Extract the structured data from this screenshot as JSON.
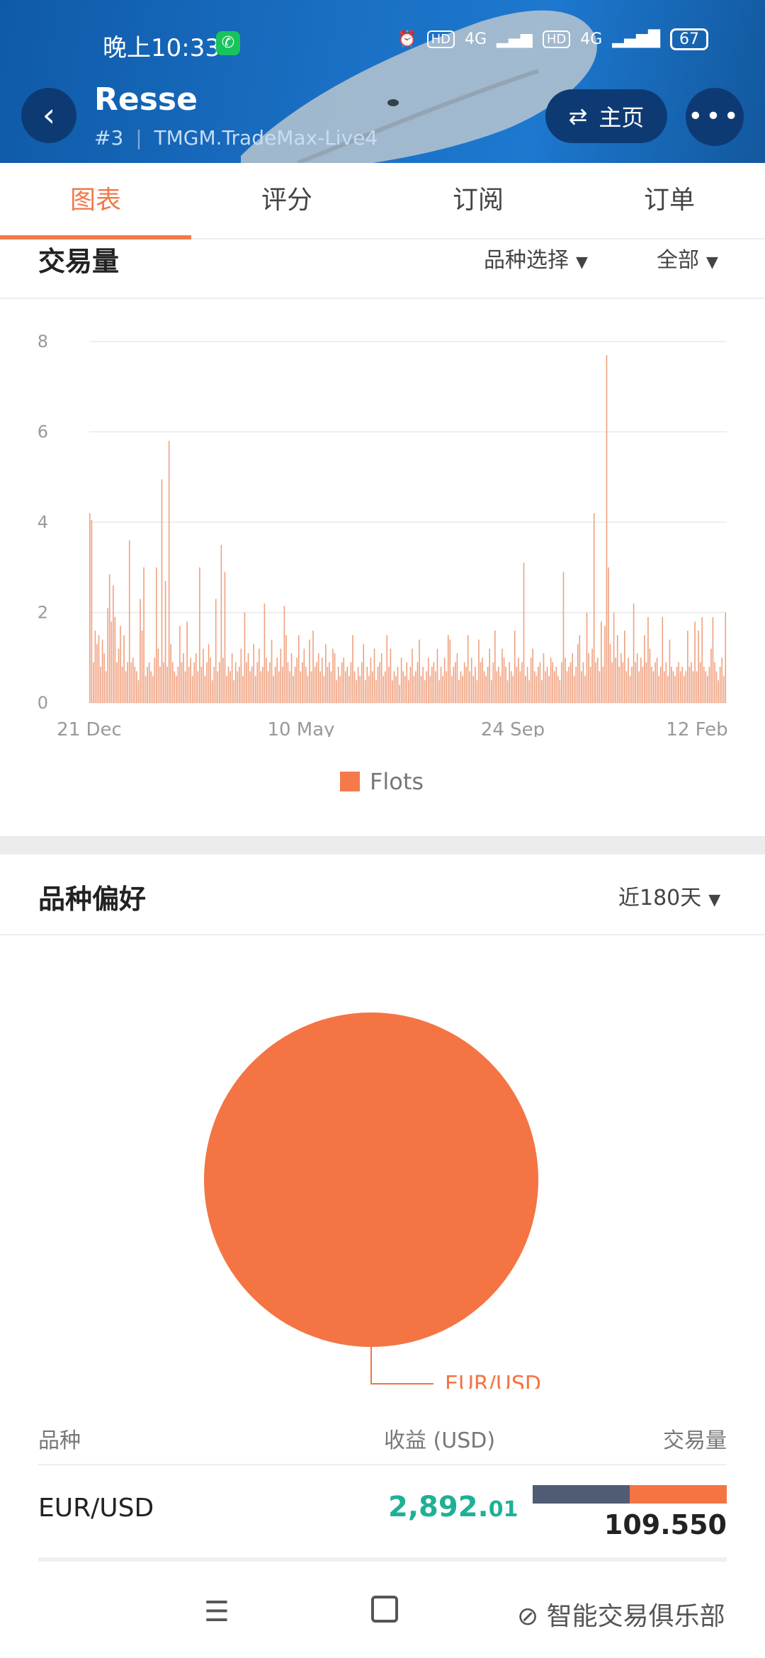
{
  "status_bar": {
    "time": "晚上10:33",
    "battery": "67",
    "network1": "4G",
    "network2": "4G",
    "hd": "HD"
  },
  "header": {
    "title": "Resse",
    "rank": "#3",
    "account": "TMGM.TradeMax-Live4",
    "home_label": "主页"
  },
  "tabs": [
    {
      "label": "图表",
      "active": true
    },
    {
      "label": "评分",
      "active": false
    },
    {
      "label": "订阅",
      "active": false
    },
    {
      "label": "订单",
      "active": false
    }
  ],
  "volume_section": {
    "title": "交易量",
    "filter_symbol": "品种选择",
    "filter_range": "全部"
  },
  "chart_data": [
    {
      "type": "bar",
      "title": "",
      "series": [
        {
          "name": "Flots",
          "color": "#f0a07e"
        }
      ],
      "x_tick_labels": [
        "21 Dec",
        "10 May",
        "24 Sep",
        "12 Feb"
      ],
      "y_ticks": [
        0,
        2,
        4,
        6,
        8
      ],
      "ylim": [
        0,
        8
      ],
      "grid": true,
      "legend": "bottom",
      "values": [
        4.2,
        4.05,
        0.9,
        1.6,
        1.3,
        1.5,
        0.8,
        1.4,
        1.1,
        0.7,
        2.1,
        2.85,
        1.8,
        2.6,
        1.9,
        0.9,
        1.2,
        1.7,
        0.8,
        1.5,
        0.7,
        0.9,
        3.6,
        0.9,
        1.0,
        0.8,
        0.7,
        0.5,
        2.3,
        1.6,
        3.0,
        0.6,
        0.8,
        0.9,
        0.7,
        0.6,
        1.0,
        3.0,
        1.2,
        0.8,
        4.95,
        0.9,
        2.7,
        0.8,
        5.8,
        1.3,
        0.9,
        0.7,
        0.6,
        0.8,
        1.7,
        0.9,
        1.1,
        0.7,
        1.8,
        0.8,
        1.0,
        0.6,
        0.9,
        1.1,
        0.7,
        3.0,
        0.8,
        1.2,
        0.6,
        0.9,
        1.3,
        1.0,
        0.5,
        0.8,
        2.3,
        0.7,
        0.9,
        3.5,
        1.0,
        2.9,
        0.6,
        0.8,
        0.7,
        1.1,
        0.5,
        0.9,
        0.7,
        0.8,
        1.2,
        0.6,
        2.0,
        0.9,
        1.1,
        0.7,
        0.8,
        1.3,
        0.6,
        0.9,
        1.2,
        0.7,
        0.8,
        2.2,
        1.0,
        0.7,
        0.9,
        1.4,
        0.6,
        0.8,
        1.0,
        0.7,
        1.2,
        0.8,
        2.15,
        1.5,
        0.9,
        0.7,
        1.1,
        0.6,
        0.8,
        1.0,
        1.5,
        0.7,
        0.9,
        1.2,
        0.8,
        0.6,
        1.4,
        0.7,
        1.6,
        0.8,
        0.9,
        1.1,
        0.7,
        1.0,
        0.6,
        1.3,
        0.8,
        0.9,
        0.7,
        1.2,
        1.1,
        0.5,
        0.8,
        0.6,
        0.9,
        1.0,
        0.7,
        0.8,
        0.6,
        0.9,
        1.5,
        0.7,
        0.5,
        0.8,
        0.6,
        0.9,
        1.3,
        0.5,
        0.8,
        0.6,
        1.0,
        0.7,
        1.2,
        0.5,
        0.8,
        0.9,
        1.1,
        0.6,
        0.7,
        1.5,
        0.8,
        1.2,
        0.5,
        0.7,
        0.6,
        0.8,
        0.4,
        1.0,
        0.7,
        0.6,
        0.9,
        0.5,
        0.8,
        1.2,
        0.6,
        0.7,
        0.9,
        1.4,
        0.6,
        0.8,
        0.5,
        0.7,
        1.0,
        0.6,
        0.8,
        0.9,
        0.7,
        1.2,
        0.5,
        0.8,
        0.6,
        1.0,
        0.7,
        1.5,
        1.4,
        0.6,
        0.8,
        0.9,
        1.1,
        0.5,
        0.7,
        0.6,
        0.9,
        0.8,
        1.5,
        0.7,
        1.0,
        0.6,
        0.8,
        0.5,
        1.4,
        0.9,
        1.0,
        0.7,
        0.6,
        0.8,
        1.2,
        0.5,
        0.9,
        1.6,
        0.7,
        0.8,
        0.6,
        1.2,
        1.0,
        0.8,
        0.5,
        0.9,
        0.7,
        0.6,
        1.6,
        0.8,
        1.0,
        0.7,
        0.9,
        3.1,
        0.6,
        0.8,
        0.5,
        1.0,
        1.2,
        0.7,
        0.6,
        0.8,
        0.9,
        0.5,
        1.1,
        0.7,
        0.8,
        0.6,
        1.0,
        0.9,
        0.7,
        0.8,
        0.6,
        0.5,
        0.9,
        2.9,
        1.0,
        0.7,
        0.8,
        0.9,
        1.1,
        0.6,
        0.8,
        1.3,
        1.5,
        0.7,
        0.9,
        0.6,
        2.0,
        1.1,
        0.8,
        1.2,
        4.2,
        0.9,
        1.0,
        0.7,
        1.8,
        0.8,
        1.7,
        7.7,
        3.0,
        1.3,
        0.9,
        2.0,
        1.0,
        1.5,
        0.8,
        1.1,
        0.9,
        1.6,
        0.7,
        1.0,
        0.6,
        0.8,
        2.2,
        0.9,
        1.1,
        0.7,
        1.0,
        0.8,
        1.5,
        0.9,
        1.9,
        1.2,
        0.8,
        0.7,
        0.9,
        1.0,
        0.6,
        0.8,
        1.9,
        0.7,
        0.9,
        0.6,
        1.4,
        0.8,
        0.7,
        0.6,
        0.8,
        0.9,
        0.7,
        0.8,
        0.6,
        0.7,
        1.6,
        0.8,
        0.9,
        0.7,
        1.8,
        0.7,
        1.6,
        0.9,
        1.9,
        0.8,
        0.7,
        0.6,
        0.8,
        1.2,
        1.9,
        0.9,
        0.7,
        0.5,
        0.8,
        1.0,
        0.6,
        2.0
      ]
    },
    {
      "type": "pie",
      "title": "",
      "categories": [
        "EUR/USD"
      ],
      "values": [
        109.55
      ],
      "colors": [
        "#f47444"
      ]
    }
  ],
  "preference_section": {
    "title": "品种偏好",
    "range": "近180天"
  },
  "pie_label": "EUR/USD",
  "table": {
    "headers": {
      "symbol": "品种",
      "profit": "收益 (USD)",
      "volume": "交易量"
    },
    "rows": [
      {
        "symbol": "EUR/USD",
        "profit_int": "2,892.",
        "profit_dec": "01",
        "volume": "109.550",
        "bar_split": 0.5
      }
    ]
  },
  "watermark": "智能交易俱乐部"
}
